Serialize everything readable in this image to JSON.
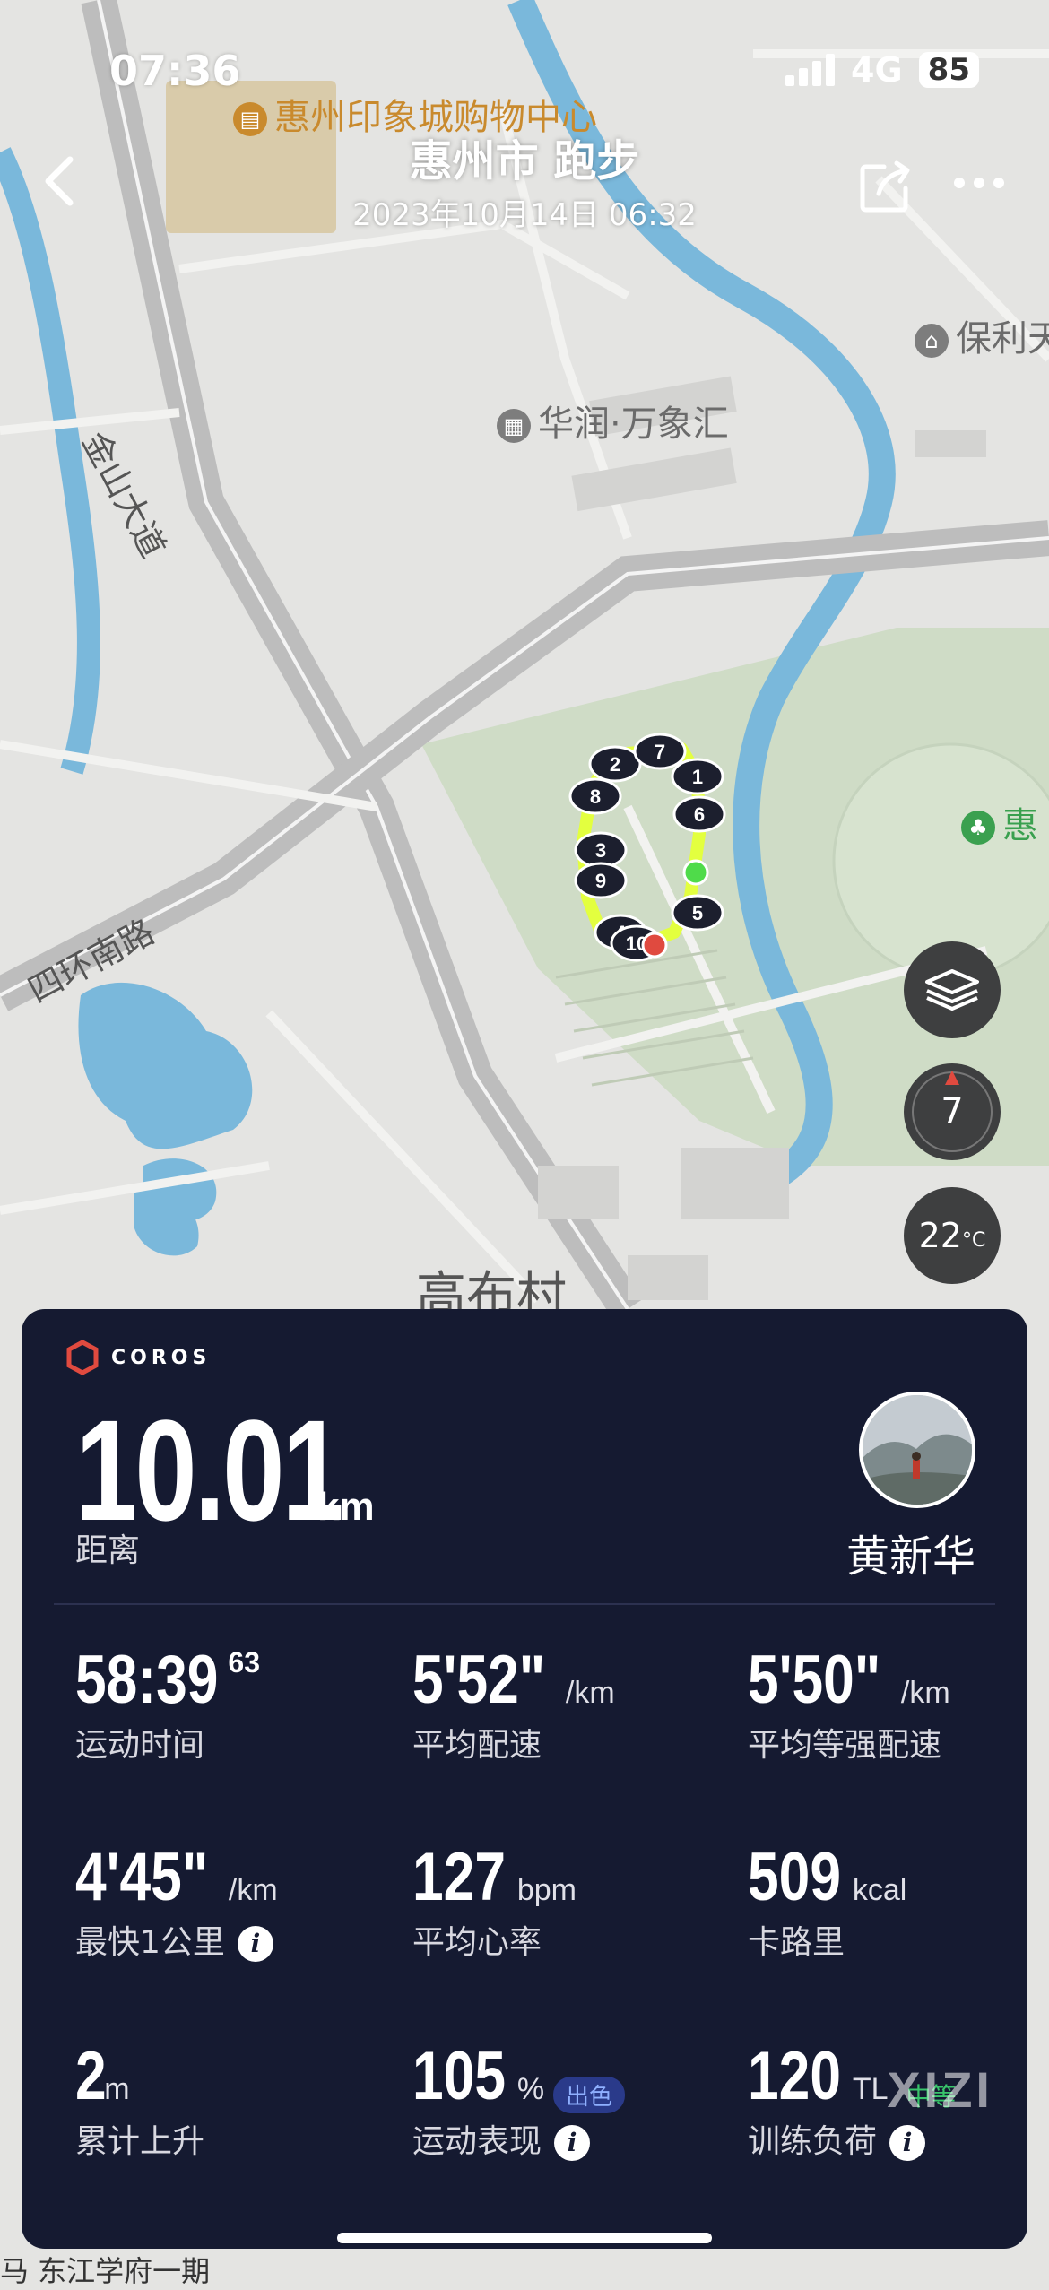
{
  "status_bar": {
    "time": "07:36",
    "network": "4G",
    "battery": "85"
  },
  "header": {
    "title": "惠州市 跑步",
    "datetime": "2023年10月14日 06:32"
  },
  "map": {
    "labels": {
      "mall": "惠州印象城购物中心",
      "poli": "保利天",
      "huarun": "华润·万象汇",
      "jinshan": "金山大道",
      "sihuan": "四环南路",
      "gaobu": "高布村",
      "hui": "惠"
    },
    "km_markers": [
      "1",
      "2",
      "3",
      "4",
      "5",
      "6",
      "7",
      "8",
      "9",
      "10"
    ],
    "compass_value": "7",
    "temperature": "22",
    "temperature_unit": "°C"
  },
  "card": {
    "brand": "COROS",
    "distance_value": "10.01",
    "distance_unit": "km",
    "distance_label": "距离",
    "username": "黄新华",
    "stats": {
      "moving_time": {
        "value": "58:39",
        "sup": "63",
        "label": "运动时间"
      },
      "avg_pace": {
        "value": "5'52\"",
        "unit": "/km",
        "label": "平均配速"
      },
      "avg_grade_pace": {
        "value": "5'50\"",
        "unit": "/km",
        "label": "平均等强配速"
      },
      "fastest_km": {
        "value": "4'45\"",
        "unit": "/km",
        "label": "最快1公里"
      },
      "avg_hr": {
        "value": "127",
        "unit": "bpm",
        "label": "平均心率"
      },
      "calories": {
        "value": "509",
        "unit": "kcal",
        "label": "卡路里"
      },
      "elev_gain": {
        "value": "2",
        "unit": "m",
        "label": "累计上升"
      },
      "performance": {
        "value": "105",
        "unit": "%",
        "badge": "出色",
        "label": "运动表现"
      },
      "training_load": {
        "value": "120",
        "unit": "TL",
        "badge": "中等",
        "label": "训练负荷"
      }
    }
  },
  "watermark": "XIZI",
  "bottom_text": "马 东江学府一期"
}
